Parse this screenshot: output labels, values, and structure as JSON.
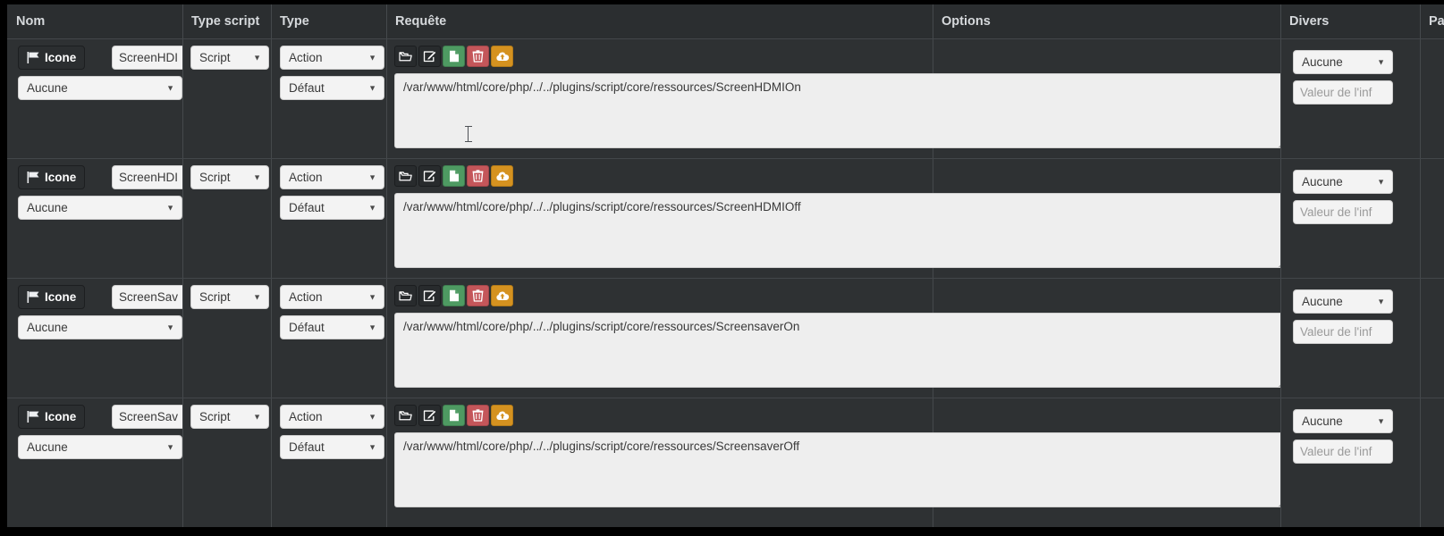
{
  "table": {
    "columns": [
      {
        "key": "nom",
        "label": "Nom"
      },
      {
        "key": "type_script",
        "label": "Type script"
      },
      {
        "key": "type",
        "label": "Type"
      },
      {
        "key": "requete",
        "label": "Requête"
      },
      {
        "key": "options",
        "label": "Options"
      },
      {
        "key": "divers",
        "label": "Divers"
      },
      {
        "key": "parent",
        "label": "Pa"
      }
    ],
    "action_icons": [
      {
        "name": "folder-open-icon",
        "style": "dark"
      },
      {
        "name": "edit-icon",
        "style": "dark"
      },
      {
        "name": "file-icon",
        "style": "green"
      },
      {
        "name": "trash-icon",
        "style": "red"
      },
      {
        "name": "cloud-upload-icon",
        "style": "orange"
      }
    ],
    "icon_button_label": "Icone",
    "divers_placeholder": "Valeur de l'inf",
    "rows": [
      {
        "icon_label": "Icone",
        "name_value": "ScreenHDI",
        "visibility": "Aucune",
        "type_script": "Script",
        "type": "Action",
        "subtype": "Défaut",
        "requete": "/var/www/html/core/php/../../plugins/script/core/ressources/ScreenHDMIOn",
        "divers_select": "Aucune",
        "divers_input": "Valeur de l'inf"
      },
      {
        "icon_label": "Icone",
        "name_value": "ScreenHDI",
        "visibility": "Aucune",
        "type_script": "Script",
        "type": "Action",
        "subtype": "Défaut",
        "requete": "/var/www/html/core/php/../../plugins/script/core/ressources/ScreenHDMIOff",
        "divers_select": "Aucune",
        "divers_input": "Valeur de l'inf"
      },
      {
        "icon_label": "Icone",
        "name_value": "ScreenSav",
        "visibility": "Aucune",
        "type_script": "Script",
        "type": "Action",
        "subtype": "Défaut",
        "requete": "/var/www/html/core/php/../../plugins/script/core/ressources/ScreensaverOn",
        "divers_select": "Aucune",
        "divers_input": "Valeur de l'inf"
      },
      {
        "icon_label": "Icone",
        "name_value": "ScreenSav",
        "visibility": "Aucune",
        "type_script": "Script",
        "type": "Action",
        "subtype": "Défaut",
        "requete": "/var/www/html/core/php/../../plugins/script/core/ressources/ScreensaverOff",
        "divers_select": "Aucune",
        "divers_input": "Valeur de l'inf"
      }
    ]
  },
  "colors": {
    "background": "#2e3133",
    "header_background": "#2b2e30",
    "border": "#43474a",
    "text_light": "#d6d9dc",
    "field_background": "#f3f3f3",
    "green": "#4e9a62",
    "red": "#c4565a",
    "orange": "#d59220"
  }
}
